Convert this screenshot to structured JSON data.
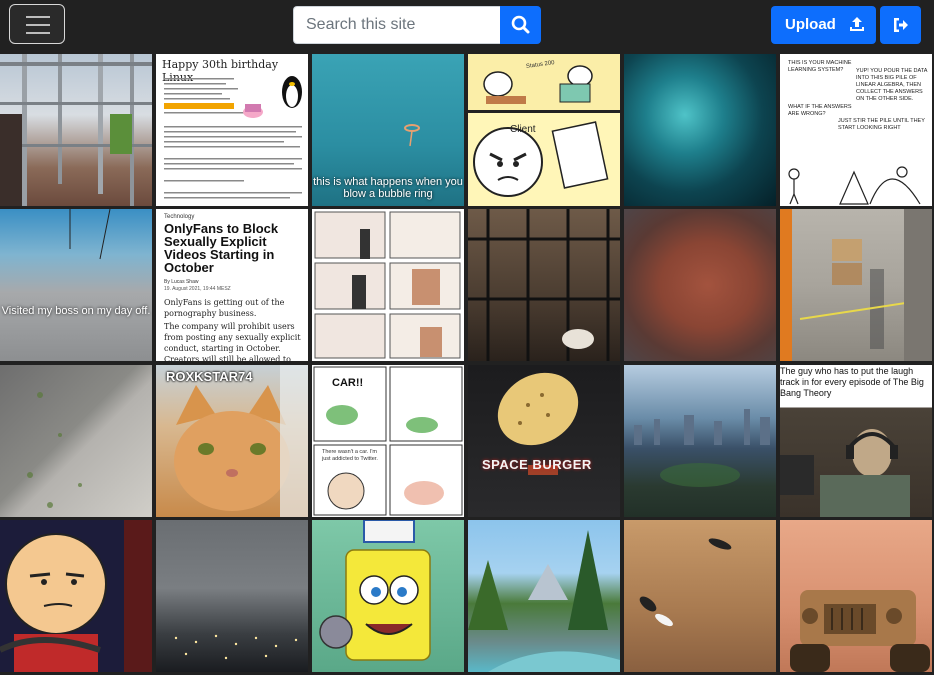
{
  "search": {
    "placeholder": "Search this site"
  },
  "nav": {
    "upload_label": "Upload"
  },
  "tiles": {
    "t01": "",
    "t02": {
      "title": "Happy 30th birthday Linux"
    },
    "t03": {
      "caption": "this is what happens when you blow a bubble ring"
    },
    "t04": {
      "top_label": "Status 200",
      "paper_label": "Client"
    },
    "t05": "",
    "t06": {
      "q1": "THIS IS YOUR MACHINE LEARNING SYSTEM?",
      "a1": "YUP! YOU POUR THE DATA INTO THIS BIG PILE OF LINEAR ALGEBRA, THEN COLLECT THE ANSWERS ON THE OTHER SIDE.",
      "q2": "WHAT IF THE ANSWERS ARE WRONG?",
      "a2": "JUST STIR THE PILE UNTIL THEY START LOOKING RIGHT"
    },
    "t07": {
      "caption": "Visited my boss on my day off."
    },
    "t08": {
      "category": "Technology",
      "headline": "OnlyFans to Block Sexually Explicit Videos Starting in October",
      "byline": "By Lucas Shaw",
      "date": "19. August 2021, 19:44 MESZ",
      "p1": "OnlyFans is getting out of the pornography business.",
      "p2": "The company will prohibit users from posting any sexually explicit conduct, starting in October. Creators will still be allowed to post"
    },
    "t09": "",
    "t10": "",
    "t11": "",
    "t12": "",
    "t13": "",
    "t14": {
      "top_text": "ROXKSTAR74"
    },
    "t15": {
      "sound": "CAR!!",
      "speech": "There wasn't a car. I'm just addicted to Twitter."
    },
    "t16": {
      "caption": "SPACE BURGER"
    },
    "t17": "",
    "t18": {
      "caption": "The guy who has to put the laugh track in for every episode of The Big Bang Theory"
    },
    "t19": "",
    "t20": "",
    "t21": "",
    "t22": "",
    "t23": "",
    "t24": ""
  }
}
